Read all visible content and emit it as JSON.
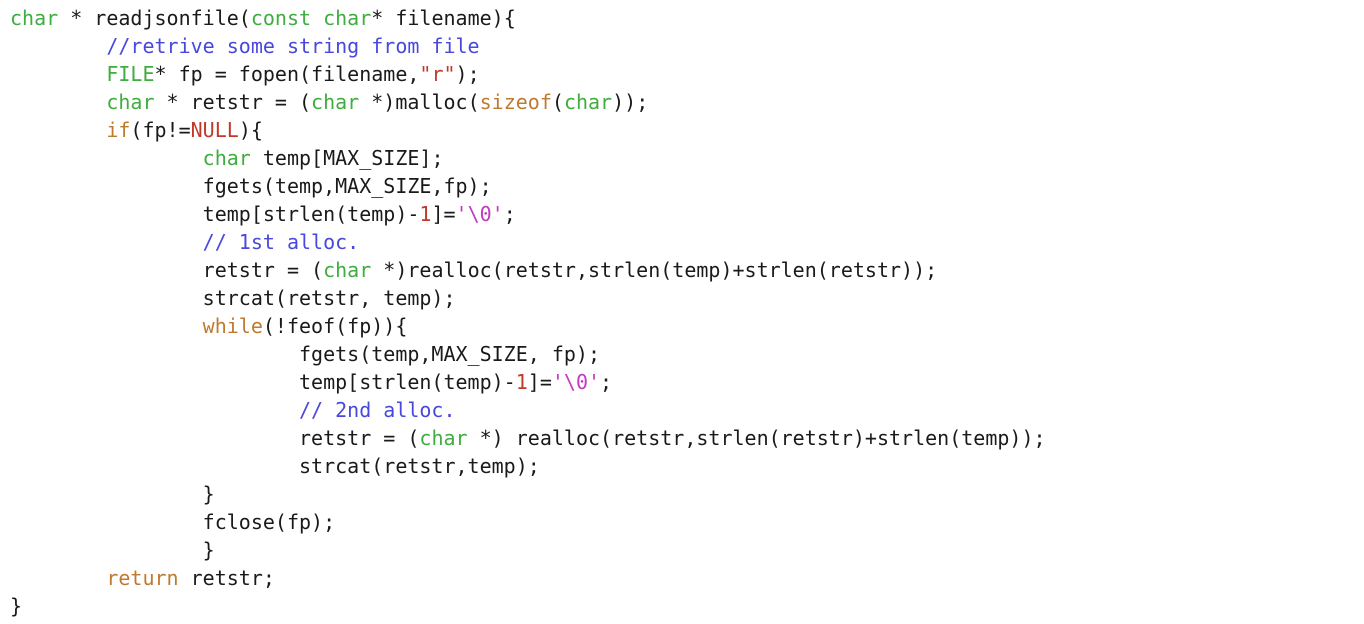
{
  "colors": {
    "background": "#ffffff",
    "plain": "#1a1a1a",
    "type": "#3fad3f",
    "keyword": "#c07a30",
    "string": "#c0392b",
    "number": "#c0392b",
    "char_literal": "#c23ac2",
    "comment": "#4848dc",
    "constant": "#c0392b"
  },
  "code": {
    "language": "C",
    "lines": [
      {
        "tokens": [
          {
            "t": "type",
            "v": "char"
          },
          {
            "t": "plain",
            "v": " * readjsonfile("
          },
          {
            "t": "type",
            "v": "const char"
          },
          {
            "t": "plain",
            "v": "* filename){"
          }
        ]
      },
      {
        "tokens": [
          {
            "t": "plain",
            "v": "        "
          },
          {
            "t": "comment",
            "v": "//retrive some string from file"
          }
        ]
      },
      {
        "tokens": [
          {
            "t": "plain",
            "v": "        "
          },
          {
            "t": "type",
            "v": "FILE"
          },
          {
            "t": "plain",
            "v": "* fp = fopen(filename,"
          },
          {
            "t": "str",
            "v": "\"r\""
          },
          {
            "t": "plain",
            "v": ");"
          }
        ]
      },
      {
        "tokens": [
          {
            "t": "plain",
            "v": "        "
          },
          {
            "t": "type",
            "v": "char"
          },
          {
            "t": "plain",
            "v": " * retstr = ("
          },
          {
            "t": "type",
            "v": "char"
          },
          {
            "t": "plain",
            "v": " *)malloc("
          },
          {
            "t": "kw",
            "v": "sizeof"
          },
          {
            "t": "plain",
            "v": "("
          },
          {
            "t": "type",
            "v": "char"
          },
          {
            "t": "plain",
            "v": "));"
          }
        ]
      },
      {
        "tokens": [
          {
            "t": "plain",
            "v": "        "
          },
          {
            "t": "kw",
            "v": "if"
          },
          {
            "t": "plain",
            "v": "(fp!="
          },
          {
            "t": "const",
            "v": "NULL"
          },
          {
            "t": "plain",
            "v": "){"
          }
        ]
      },
      {
        "tokens": [
          {
            "t": "plain",
            "v": "                "
          },
          {
            "t": "type",
            "v": "char"
          },
          {
            "t": "plain",
            "v": " temp[MAX_SIZE];"
          }
        ]
      },
      {
        "tokens": [
          {
            "t": "plain",
            "v": "                fgets(temp,MAX_SIZE,fp);"
          }
        ]
      },
      {
        "tokens": [
          {
            "t": "plain",
            "v": "                temp[strlen(temp)-"
          },
          {
            "t": "num",
            "v": "1"
          },
          {
            "t": "plain",
            "v": "]="
          },
          {
            "t": "char",
            "v": "'\\0'"
          },
          {
            "t": "plain",
            "v": ";"
          }
        ]
      },
      {
        "tokens": [
          {
            "t": "plain",
            "v": "                "
          },
          {
            "t": "comment",
            "v": "// 1st alloc."
          }
        ]
      },
      {
        "tokens": [
          {
            "t": "plain",
            "v": "                retstr = ("
          },
          {
            "t": "type",
            "v": "char"
          },
          {
            "t": "plain",
            "v": " *)realloc(retstr,strlen(temp)+strlen(retstr));"
          }
        ]
      },
      {
        "tokens": [
          {
            "t": "plain",
            "v": "                strcat(retstr, temp);"
          }
        ]
      },
      {
        "tokens": [
          {
            "t": "plain",
            "v": "                "
          },
          {
            "t": "kw",
            "v": "while"
          },
          {
            "t": "plain",
            "v": "(!feof(fp)){"
          }
        ]
      },
      {
        "tokens": [
          {
            "t": "plain",
            "v": "                        fgets(temp,MAX_SIZE, fp);"
          }
        ]
      },
      {
        "tokens": [
          {
            "t": "plain",
            "v": "                        temp[strlen(temp)-"
          },
          {
            "t": "num",
            "v": "1"
          },
          {
            "t": "plain",
            "v": "]="
          },
          {
            "t": "char",
            "v": "'\\0'"
          },
          {
            "t": "plain",
            "v": ";"
          }
        ]
      },
      {
        "tokens": [
          {
            "t": "plain",
            "v": "                        "
          },
          {
            "t": "comment",
            "v": "// 2nd alloc."
          }
        ]
      },
      {
        "tokens": [
          {
            "t": "plain",
            "v": "                        retstr = ("
          },
          {
            "t": "type",
            "v": "char"
          },
          {
            "t": "plain",
            "v": " *) realloc(retstr,strlen(retstr)+strlen(temp));"
          }
        ]
      },
      {
        "tokens": [
          {
            "t": "plain",
            "v": "                        strcat(retstr,temp);"
          }
        ]
      },
      {
        "tokens": [
          {
            "t": "plain",
            "v": "                }"
          }
        ]
      },
      {
        "tokens": [
          {
            "t": "plain",
            "v": "                fclose(fp);"
          }
        ]
      },
      {
        "tokens": [
          {
            "t": "plain",
            "v": "                }"
          }
        ]
      },
      {
        "tokens": [
          {
            "t": "plain",
            "v": "        "
          },
          {
            "t": "kw",
            "v": "return"
          },
          {
            "t": "plain",
            "v": " retstr;"
          }
        ]
      },
      {
        "tokens": [
          {
            "t": "plain",
            "v": "}"
          }
        ]
      }
    ]
  }
}
